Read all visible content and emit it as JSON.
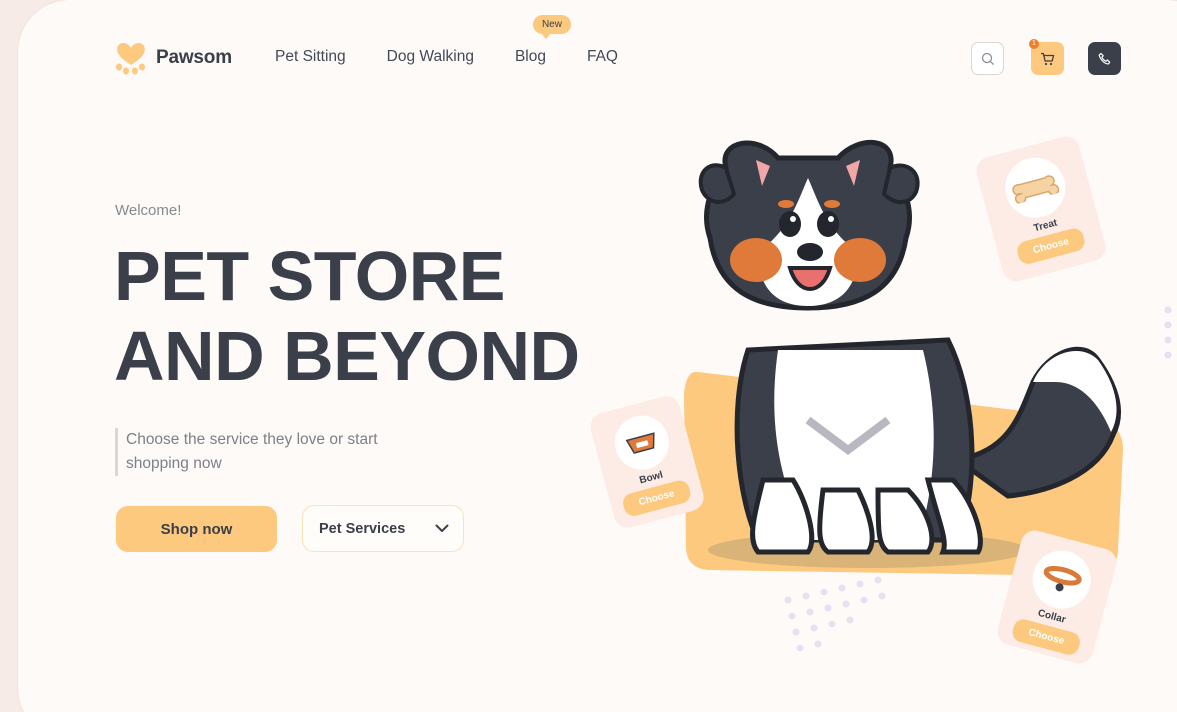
{
  "brand": {
    "name": "Pawsom",
    "accent": "#fcc97e",
    "dark": "#3a3f4a"
  },
  "nav": {
    "items": [
      {
        "label": "Pet Sitting"
      },
      {
        "label": "Dog Walking"
      },
      {
        "label": "Blog",
        "badge": "New"
      },
      {
        "label": "FAQ"
      }
    ]
  },
  "header_actions": {
    "search_icon": "search-icon",
    "cart_icon": "cart-icon",
    "cart_count": "1",
    "phone_icon": "phone-icon"
  },
  "hero": {
    "welcome": "Welcome!",
    "headline_line1": "PET STORE",
    "headline_line2": "AND BEYOND",
    "subtitle": "Choose the service they love or start shopping now",
    "shop_button": "Shop now",
    "service_select": "Pet Services"
  },
  "products": [
    {
      "name": "Treat",
      "action": "Choose",
      "icon": "bone-icon"
    },
    {
      "name": "Bowl",
      "action": "Choose",
      "icon": "bowl-icon"
    },
    {
      "name": "Collar",
      "action": "Choose",
      "icon": "collar-icon"
    }
  ]
}
